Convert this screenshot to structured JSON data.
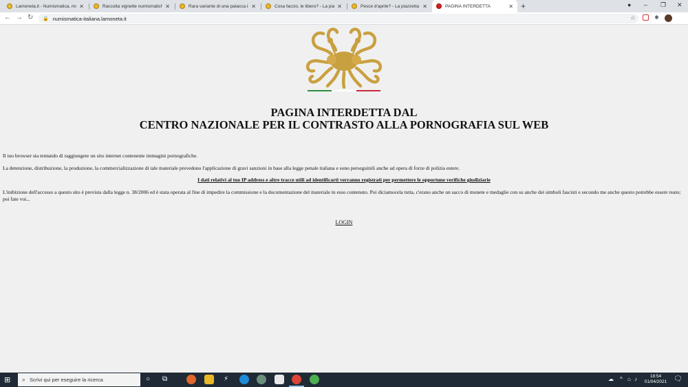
{
  "browser": {
    "tabs": [
      {
        "title": "Lamoneta.it - Numismatica, mon",
        "active": false
      },
      {
        "title": "Raccolta vignette numismatiche",
        "active": false
      },
      {
        "title": "Rara variante di una patacca ine",
        "active": false
      },
      {
        "title": "Cosa faccio, le libero? - La piazz",
        "active": false
      },
      {
        "title": "Pesce d'aprile? - La piazzetta de",
        "active": false
      },
      {
        "title": "PAGINA INTERDETTA",
        "active": true
      }
    ],
    "new_tab": "+",
    "url": "numismatica-italiana.lamoneta.it",
    "nav": {
      "back": "←",
      "forward": "→",
      "reload": "↻"
    },
    "lock": "🔒",
    "star": "☆",
    "window": {
      "minimize": "–",
      "restore": "❐",
      "close": "✕",
      "record": "●"
    }
  },
  "page": {
    "headline_line1": "PAGINA INTERDETTA DAL",
    "headline_line2": "CENTRO NAZIONALE PER IL CONTRASTO ALLA PORNOGRAFIA SUL WEB",
    "p1": "Il tuo browser sta tentando di raggiungere un sito internet contenente immagini pornografiche.",
    "p2": "La detenzione, distribuzione, la produzione, la commercializzazione di tale materiale prevedono l'applicazione di gravi sanzioni in base alla legge penale italiana e sono perseguinili anche ad opera di forze di polizia estere.",
    "warning": "I dati relativi al tuo IP address e altre tracce utili ad identificarti verranno registrati per permettere le opportune verifiche giudiziarie",
    "p3": "L'inibizione dell'accesso a questo sito è prevista dalla legge n. 38/2006 ed è stata operata al fine di impedire la commissione e la documentazione del materiale in esso contenuto. Poi diciamocela tutta, c'erano anche un sacco di monete e medaglie con su anche dei simboli fascisti e secondo me anche questo potrebbe essere reato; poi fate voi...",
    "login": "LOGIN",
    "flag_colors": [
      "#2e8b3e",
      "#ffffff",
      "#c8283a"
    ],
    "logo_color": "#c9a040"
  },
  "taskbar": {
    "start": "⊞",
    "search_placeholder": "Scrivi qui per eseguire la ricerca",
    "search_icon": "⌕",
    "time": "18:54",
    "date": "01/04/2021",
    "notification": "🗨"
  }
}
